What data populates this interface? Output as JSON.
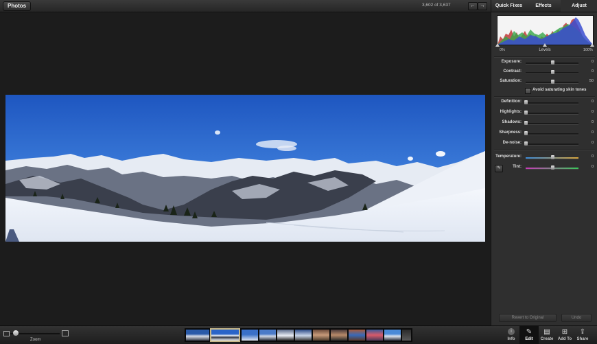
{
  "topbar": {
    "photos_label": "Photos",
    "counter": "3,602 of 3,637",
    "prev_glyph": "←",
    "next_glyph": "→"
  },
  "panel": {
    "tabs": [
      {
        "label": "Quick Fixes"
      },
      {
        "label": "Effects"
      },
      {
        "label": "Adjust"
      }
    ],
    "active_tab": "Adjust",
    "levels": {
      "min": "0%",
      "title": "Levels",
      "max": "100%"
    },
    "sliders": [
      {
        "label": "Exposure:",
        "value": "0",
        "fraction": 0.5
      },
      {
        "label": "Contrast:",
        "value": "0",
        "fraction": 0.5
      },
      {
        "label": "Saturation:",
        "value": "50",
        "fraction": 0.5
      },
      {
        "label": "Definition:",
        "value": "0",
        "fraction": 0.0
      },
      {
        "label": "Highlights:",
        "value": "0",
        "fraction": 0.0
      },
      {
        "label": "Shadows:",
        "value": "0",
        "fraction": 0.0
      },
      {
        "label": "Sharpness:",
        "value": "0",
        "fraction": 0.0
      },
      {
        "label": "De-noise:",
        "value": "0",
        "fraction": 0.0
      },
      {
        "label": "Temperature:",
        "value": "0",
        "fraction": 0.5
      },
      {
        "label": "Tint:",
        "value": "0",
        "fraction": 0.5
      }
    ],
    "skin_tones_label": "Avoid saturating skin tones",
    "revert_label": "Revert to Original",
    "undo_label": "Undo"
  },
  "bottombar": {
    "zoom_label": "Zoom",
    "zoom_fraction": 0.05,
    "tools": [
      {
        "label": "Info",
        "icon": "info-icon"
      },
      {
        "label": "Edit",
        "icon": "pencil-icon"
      },
      {
        "label": "Create",
        "icon": "create-icon"
      },
      {
        "label": "Add To",
        "icon": "add-icon"
      },
      {
        "label": "Share",
        "icon": "share-icon"
      }
    ]
  },
  "colors": {
    "accent_selected": "#c9b98a",
    "sky": "#2a64c8",
    "snow": "#eef2f8"
  }
}
